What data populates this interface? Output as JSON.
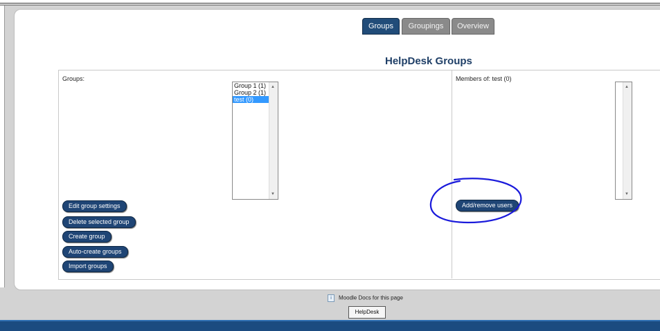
{
  "tabs": [
    {
      "label": "Groups",
      "active": true
    },
    {
      "label": "Groupings",
      "active": false
    },
    {
      "label": "Overview",
      "active": false
    }
  ],
  "page_title": "HelpDesk Groups",
  "groups_panel": {
    "label": "Groups:",
    "options": [
      "Group 1 (1)",
      "Group 2 (1)",
      "test (0)"
    ],
    "selected": "test (0)",
    "buttons": {
      "edit": "Edit group settings",
      "delete": "Delete selected group",
      "create": "Create group",
      "auto_create": "Auto-create groups",
      "import": "Import groups"
    }
  },
  "members_panel": {
    "label": "Members of: test (0)",
    "add_remove_button": "Add/remove users"
  },
  "footer": {
    "docs_link": "Moodle Docs for this page",
    "info_icon_glyph": "i",
    "course_button": "HelpDesk"
  },
  "colors": {
    "accent": "#1f4575",
    "annotation": "#1a1adb",
    "selection": "#3399ff"
  }
}
